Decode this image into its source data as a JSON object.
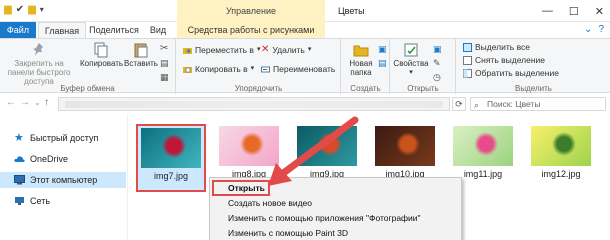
{
  "titlebar": {
    "context_group": "Управление",
    "title": "Цветы",
    "minimize": "—",
    "maximize": "☐",
    "close": "✕"
  },
  "tabs": [
    {
      "label": "Файл"
    },
    {
      "label": "Главная"
    },
    {
      "label": "Поделиться"
    },
    {
      "label": "Вид"
    },
    {
      "label": "Средства работы с рисунками"
    }
  ],
  "ribbon": {
    "clipboard": {
      "pin": "Закрепить на панели быстрого доступа",
      "copy": "Копировать",
      "paste": "Вставить",
      "group": "Буфер обмена"
    },
    "organize": {
      "move_to": "Переместить в",
      "copy_to": "Копировать в",
      "delete": "Удалить",
      "rename": "Переименовать",
      "group": "Упорядочить"
    },
    "create": {
      "new_folder": "Новая папка",
      "group": "Создать"
    },
    "open": {
      "properties": "Свойства",
      "group": "Открыть"
    },
    "select": {
      "select_all": "Выделить все",
      "select_none": "Снять выделение",
      "invert": "Обратить выделение",
      "group": "Выделить"
    }
  },
  "address": {
    "search_placeholder": "Поиск: Цветы"
  },
  "sidebar": {
    "items": [
      {
        "label": "Быстрый доступ"
      },
      {
        "label": "OneDrive"
      },
      {
        "label": "Этот компьютер"
      },
      {
        "label": "Сеть"
      }
    ]
  },
  "files": [
    {
      "name": "img7.jpg",
      "selected": true,
      "colors": [
        "#0f6f7f",
        "#3fb6c0",
        "#c0163a"
      ]
    },
    {
      "name": "img8.jpg",
      "selected": false,
      "colors": [
        "#f6d8e6",
        "#f3a6c8",
        "#e86a2a"
      ]
    },
    {
      "name": "img9.jpg",
      "selected": false,
      "colors": [
        "#0b5a64",
        "#2f9aa0",
        "#d94a2a"
      ]
    },
    {
      "name": "img10.jpg",
      "selected": false,
      "colors": [
        "#3a1a12",
        "#7a3a1c",
        "#c8531c"
      ]
    },
    {
      "name": "img11.jpg",
      "selected": false,
      "colors": [
        "#d9f0c4",
        "#9bd37e",
        "#e84b8a"
      ]
    },
    {
      "name": "img12.jpg",
      "selected": false,
      "colors": [
        "#f7f06a",
        "#9ed34e",
        "#3a7d2a"
      ]
    }
  ],
  "context_menu": {
    "items": [
      {
        "label": "Открыть",
        "bold": true
      },
      {
        "label": "Создать новое видео",
        "bold": false
      },
      {
        "label": "Изменить с помощью приложения \"Фотографии\"",
        "bold": false
      },
      {
        "label": "Изменить с помощью Paint 3D",
        "bold": false
      }
    ]
  },
  "colors": {
    "accent": "#1979ca",
    "annotation_red": "#e34b4b",
    "selection": "#cce8ff",
    "context_tab": "#fff2c2"
  }
}
